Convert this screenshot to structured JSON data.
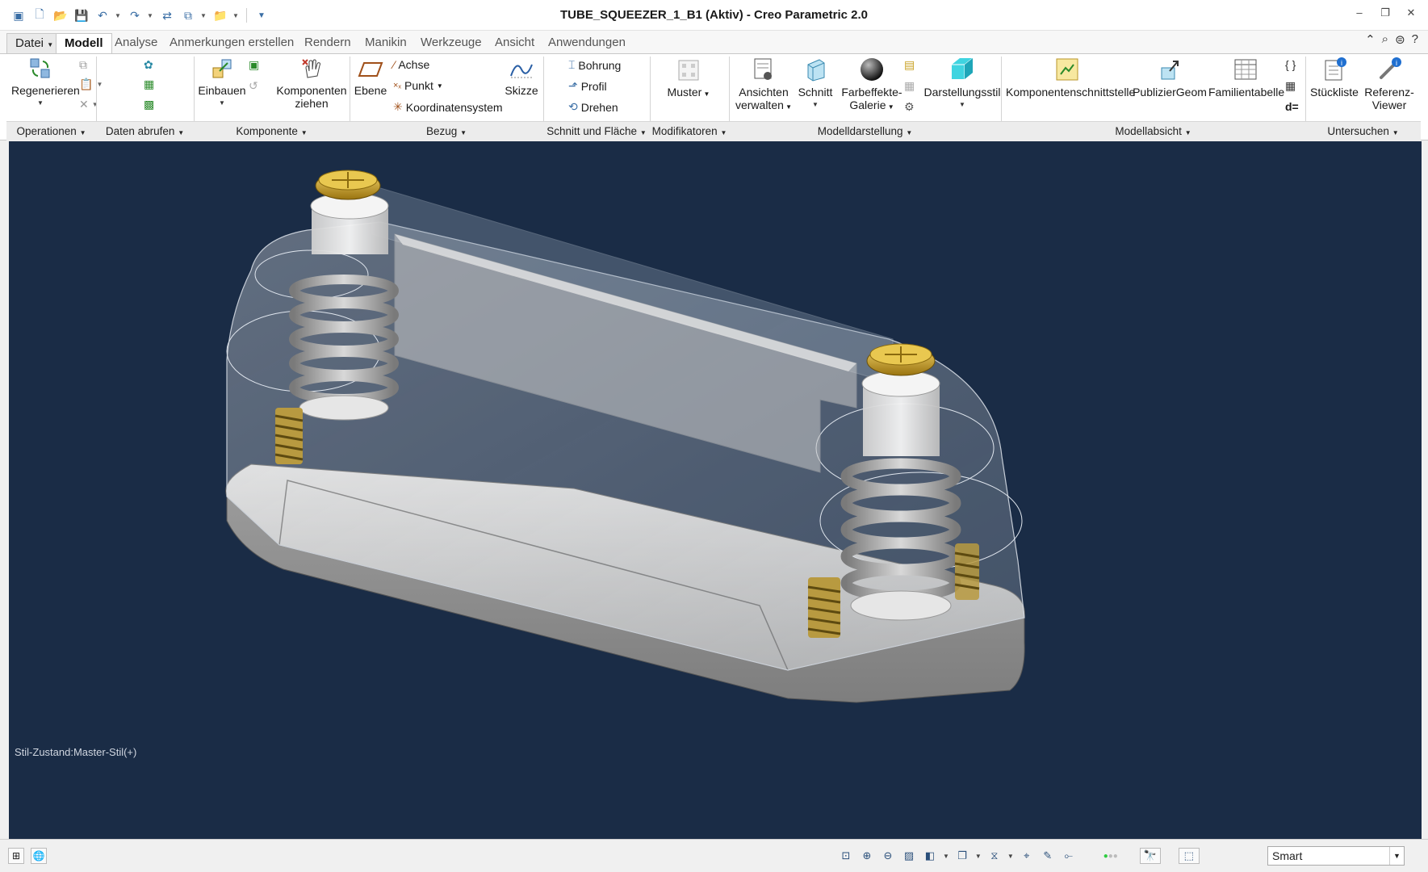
{
  "window": {
    "title": "TUBE_SQUEEZER_1_B1 (Aktiv) - Creo Parametric 2.0"
  },
  "quick_access": {
    "icons": [
      "app-icon",
      "new-icon",
      "open-icon",
      "save-icon",
      "undo-icon",
      "redo-icon",
      "regenerate-icon",
      "windows-icon",
      "folder-icon",
      "customize-icon"
    ]
  },
  "tabs": [
    {
      "label": "Datei"
    },
    {
      "label": "Modell"
    },
    {
      "label": "Analyse"
    },
    {
      "label": "Anmerkungen erstellen"
    },
    {
      "label": "Rendern"
    },
    {
      "label": "Manikin"
    },
    {
      "label": "Werkzeuge"
    },
    {
      "label": "Ansicht"
    },
    {
      "label": "Anwendungen"
    }
  ],
  "ribbon": {
    "regenerate": "Regenerieren",
    "einbauen": "Einbauen",
    "komponenten_ziehen_1": "Komponenten",
    "komponenten_ziehen_2": "ziehen",
    "ebene": "Ebene",
    "achse": "Achse",
    "punkt": "Punkt",
    "koordinatensystem": "Koordinatensystem",
    "skizze": "Skizze",
    "bohrung": "Bohrung",
    "profil": "Profil",
    "drehen": "Drehen",
    "muster": "Muster",
    "ansichten_1": "Ansichten",
    "ansichten_2": "verwalten",
    "schnitt": "Schnitt",
    "farbeffekte_1": "Farbeffekte-",
    "farbeffekte_2": "Galerie",
    "darstellungsstil": "Darstellungsstil",
    "komponentenschnittstelle": "Komponentenschnittstelle",
    "publiziergeom": "PublizierGeom",
    "familientabelle": "Familientabelle",
    "stueckliste": "Stückliste",
    "referenz_1": "Referenz-",
    "referenz_2": "Viewer",
    "d_equals": "d="
  },
  "groups": {
    "operationen": "Operationen",
    "daten_abrufen": "Daten abrufen",
    "komponente": "Komponente",
    "bezug": "Bezug",
    "schnitt_flaeche": "Schnitt und Fläche",
    "modifikatoren": "Modifikatoren",
    "modelldarstellung": "Modelldarstellung",
    "modellabsicht": "Modellabsicht",
    "untersuchen": "Untersuchen"
  },
  "viewport": {
    "style_state": "Stil-Zustand:Master-Stil(+)",
    "background": "#1a2c46"
  },
  "statusbar": {
    "filter_value": "Smart"
  }
}
